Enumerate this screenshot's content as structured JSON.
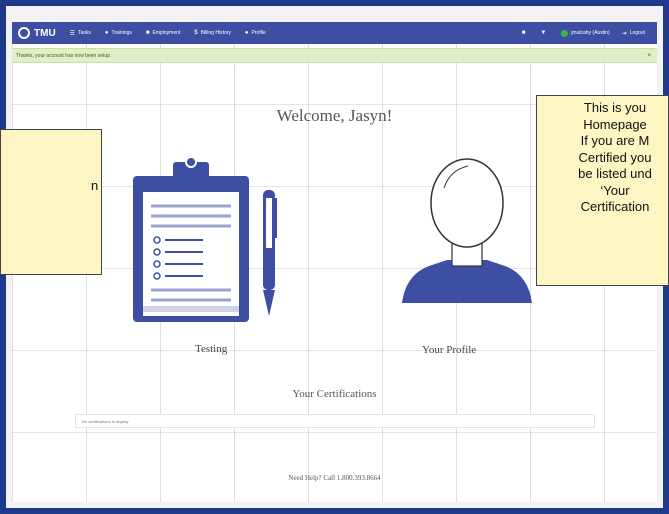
{
  "topbar": {
    "brand": "TMU",
    "nav": [
      {
        "label": "Tasks"
      },
      {
        "label": "Trainings"
      },
      {
        "label": "Employment"
      },
      {
        "label": "Billing History"
      },
      {
        "label": "Profile"
      }
    ],
    "user": "jmulcahy (Austin)",
    "logout": "Logout"
  },
  "alert": {
    "text": "Thanks, your account has now been setup."
  },
  "welcome": "Welcome, Jasyn!",
  "cards": {
    "testing_label": "Testing",
    "profile_label": "Your Profile"
  },
  "certifications": {
    "title": "Your Certifications",
    "empty_text": "No certifications to display"
  },
  "footer": {
    "help": "Need Help? Call 1.800.393.8664"
  },
  "callouts": {
    "left_fragment": "n",
    "right_lines": [
      "This is you",
      "Homepage",
      "If you are M",
      "Certified you",
      "be listed und",
      "‘Your",
      "Certification"
    ]
  },
  "colors": {
    "brand_blue": "#3e4fa3",
    "frame_blue": "#1f3a8a",
    "alert_green": "#dff0c8",
    "callout_yellow": "#fdf6c4"
  }
}
